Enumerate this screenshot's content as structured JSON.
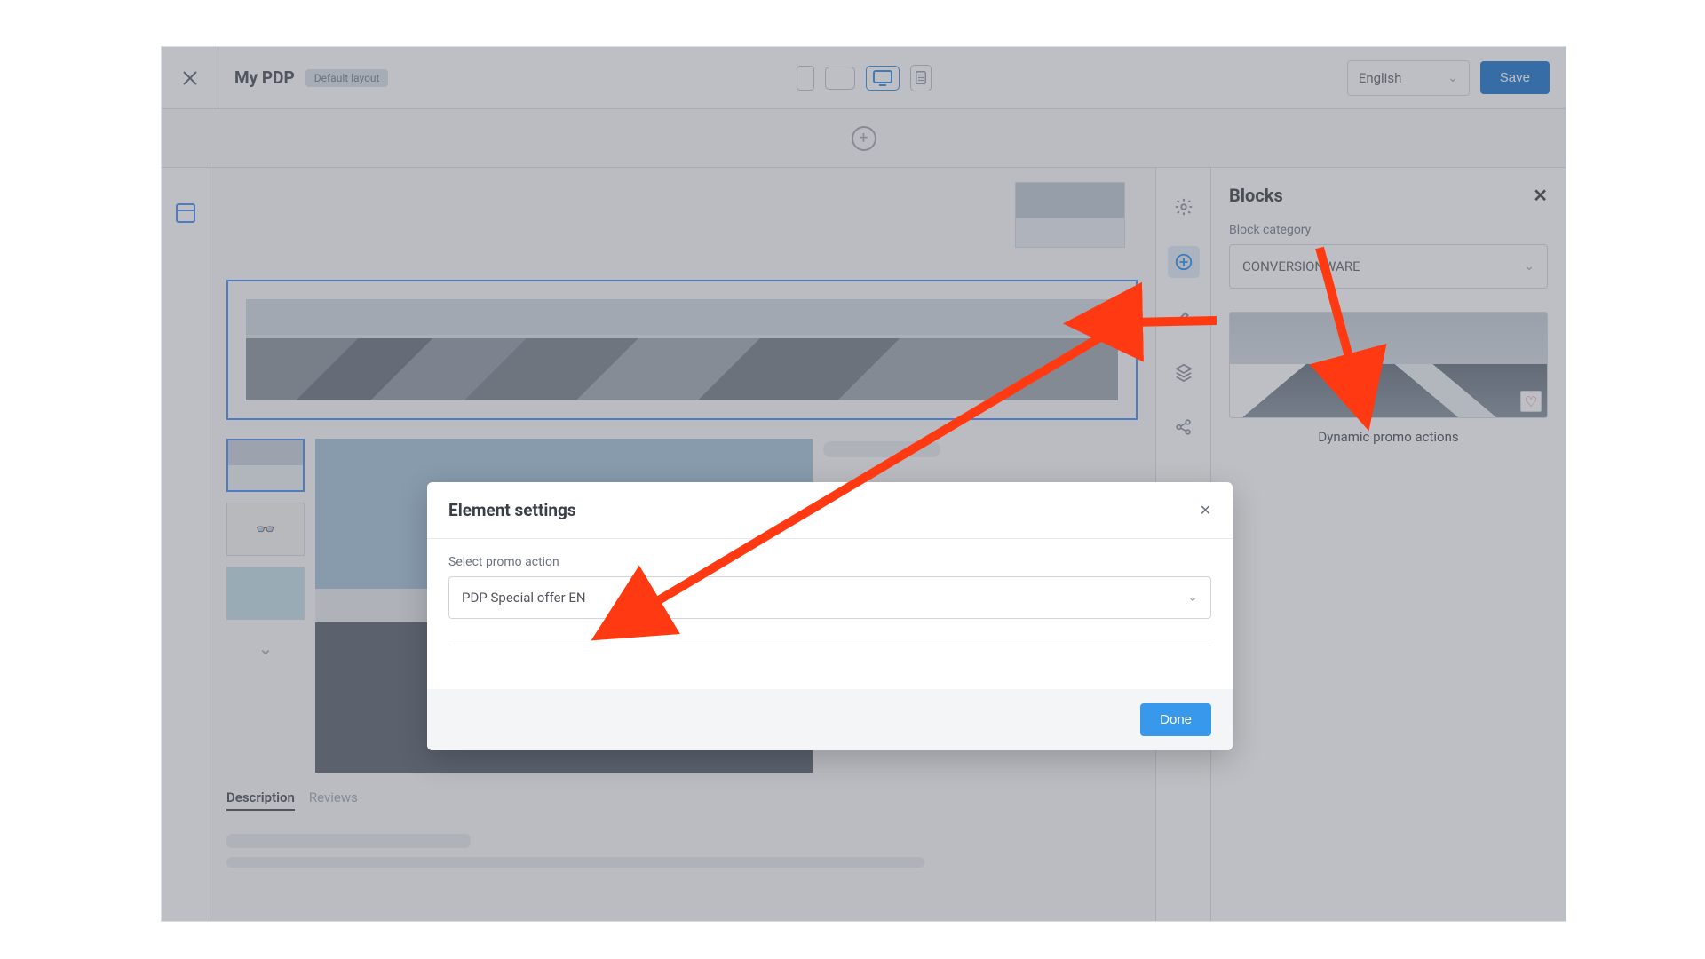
{
  "header": {
    "title": "My PDP",
    "badge": "Default layout",
    "language": "English",
    "save": "Save"
  },
  "blocks": {
    "panel_title": "Blocks",
    "category_label": "Block category",
    "category_value": "CONVERSIONWARE",
    "item_name": "Dynamic promo actions"
  },
  "tabs": {
    "description": "Description",
    "reviews": "Reviews"
  },
  "modal": {
    "title": "Element settings",
    "field_label": "Select promo action",
    "field_value": "PDP Special offer EN",
    "done": "Done"
  },
  "icons": {
    "close": "✕",
    "chevron_down": "⌄",
    "plus": "+",
    "heart": "♡"
  }
}
